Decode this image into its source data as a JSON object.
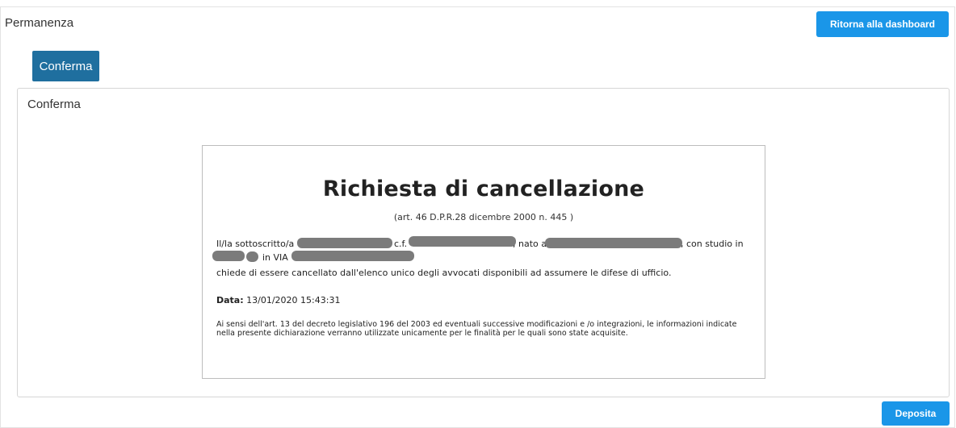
{
  "header": {
    "title": "Permanenza",
    "dashboard_button": "Ritorna alla dashboard"
  },
  "tabs": {
    "active": "Conferma"
  },
  "panel": {
    "title": "Conferma",
    "document": {
      "title": "Richiesta di cancellazione",
      "subtitle": "(art. 46 D.P.R.28 dicembre 2000 n. 445 )",
      "line1_prefix": "Il/la sottoscritto/a",
      "line1_cf": "c.f.",
      "line1_nato": ", nato a",
      "line1_studio": ", con studio in",
      "line2_via": "in VIA",
      "line3": "chiede di essere cancellato dall'elenco unico degli avvocati disponibili ad assumere le difese di ufficio.",
      "date_label": "Data:",
      "date_value": "13/01/2020 15:43:31",
      "note": "Ai sensi dell'art. 13 del decreto legislativo 196 del 2003 ed eventuali successive modificazioni e /o integrazioni, le informazioni indicate nella presente dichiarazione verranno utilizzate unicamente per le finalità per le quali sono state acquisite."
    }
  },
  "footer": {
    "deposit_button": "Deposita"
  },
  "colors": {
    "primary": "#1a96e8",
    "tab_active": "#1f6f9f",
    "redaction": "#7b7b7b"
  }
}
